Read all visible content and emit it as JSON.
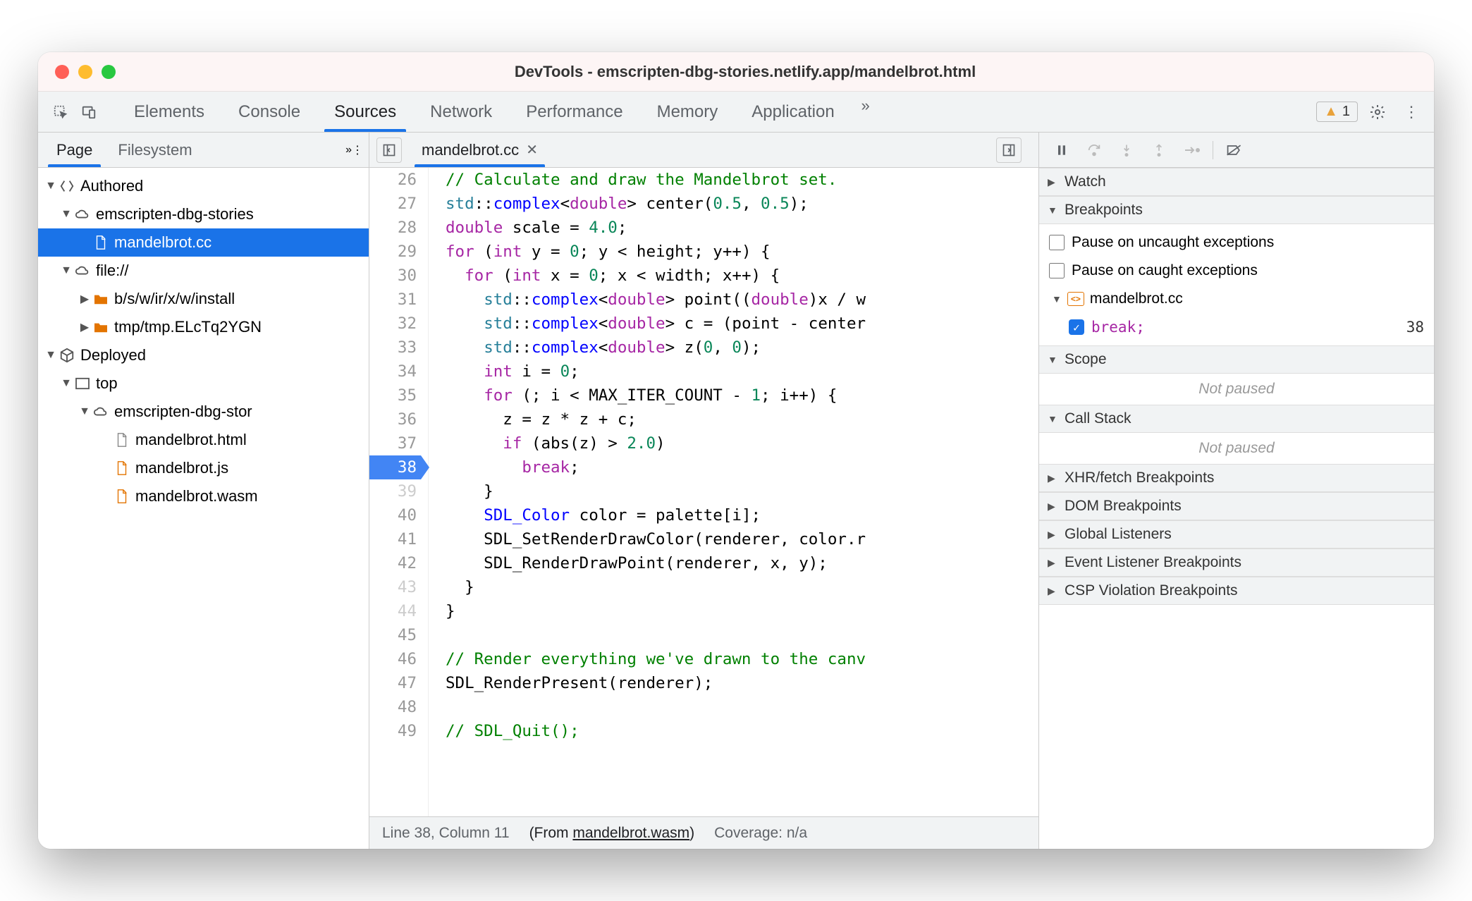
{
  "window_title": "DevTools - emscripten-dbg-stories.netlify.app/mandelbrot.html",
  "panel_tabs": [
    "Elements",
    "Console",
    "Sources",
    "Network",
    "Performance",
    "Memory",
    "Application"
  ],
  "active_panel": "Sources",
  "warning_count": "1",
  "sidebar": {
    "tabs": [
      "Page",
      "Filesystem"
    ],
    "active_tab": "Page",
    "tree": {
      "authored_label": "Authored",
      "domain1": "emscripten-dbg-stories",
      "file_cc": "mandelbrot.cc",
      "file_scheme": "file://",
      "folder1": "b/s/w/ir/x/w/install",
      "folder2": "tmp/tmp.ELcTq2YGN",
      "deployed_label": "Deployed",
      "top_label": "top",
      "domain2": "emscripten-dbg-stor",
      "dep_file1": "mandelbrot.html",
      "dep_file2": "mandelbrot.js",
      "dep_file3": "mandelbrot.wasm"
    }
  },
  "editor": {
    "filename": "mandelbrot.cc",
    "breakpoint_line": 38,
    "status_pos": "Line 38, Column 11",
    "status_from_prefix": "(From ",
    "status_from_link": "mandelbrot.wasm",
    "status_from_suffix": ")",
    "status_coverage": "Coverage: n/a"
  },
  "code_lines": [
    {
      "n": 26,
      "html": "<span class='tok-comment'>// Calculate and draw the Mandelbrot set.</span>"
    },
    {
      "n": 27,
      "html": "<span class='tok-ns'>std</span>::<span class='tok-type'>complex</span>&lt;<span class='tok-kw'>double</span>&gt; <span class='tok-id'>center</span>(<span class='tok-num'>0.5</span>, <span class='tok-num'>0.5</span>);"
    },
    {
      "n": 28,
      "html": "<span class='tok-kw'>double</span> scale = <span class='tok-num'>4.0</span>;"
    },
    {
      "n": 29,
      "html": "<span class='tok-kw'>for</span> (<span class='tok-kw'>int</span> y = <span class='tok-num'>0</span>; y &lt; height; y++) {"
    },
    {
      "n": 30,
      "html": "  <span class='tok-kw'>for</span> (<span class='tok-kw'>int</span> x = <span class='tok-num'>0</span>; x &lt; width; x++) {"
    },
    {
      "n": 31,
      "html": "    <span class='tok-ns'>std</span>::<span class='tok-type'>complex</span>&lt;<span class='tok-kw'>double</span>&gt; point((<span class='tok-kw'>double</span>)x / w"
    },
    {
      "n": 32,
      "html": "    <span class='tok-ns'>std</span>::<span class='tok-type'>complex</span>&lt;<span class='tok-kw'>double</span>&gt; c = (point - center"
    },
    {
      "n": 33,
      "html": "    <span class='tok-ns'>std</span>::<span class='tok-type'>complex</span>&lt;<span class='tok-kw'>double</span>&gt; z(<span class='tok-num'>0</span>, <span class='tok-num'>0</span>);"
    },
    {
      "n": 34,
      "html": "    <span class='tok-kw'>int</span> i = <span class='tok-num'>0</span>;"
    },
    {
      "n": 35,
      "html": "    <span class='tok-kw'>for</span> (; i &lt; MAX_ITER_COUNT - <span class='tok-num'>1</span>; i++) {"
    },
    {
      "n": 36,
      "html": "      z = z * z + c;"
    },
    {
      "n": 37,
      "html": "      <span class='tok-kw'>if</span> (abs(z) &gt; <span class='tok-num'>2.0</span>)"
    },
    {
      "n": 38,
      "bp": true,
      "html": "        <span class='tok-kw'>break</span>;"
    },
    {
      "n": 39,
      "end": true,
      "html": "    }"
    },
    {
      "n": 40,
      "html": "    <span class='tok-type'>SDL_Color</span> color = palette[i];"
    },
    {
      "n": 41,
      "html": "    SDL_SetRenderDrawColor(renderer, color.r"
    },
    {
      "n": 42,
      "html": "    SDL_RenderDrawPoint(renderer, x, y);"
    },
    {
      "n": 43,
      "end": true,
      "html": "  }"
    },
    {
      "n": 44,
      "end": true,
      "html": "}"
    },
    {
      "n": 45,
      "html": ""
    },
    {
      "n": 46,
      "html": "<span class='tok-comment'>// Render everything we've drawn to the canv</span>"
    },
    {
      "n": 47,
      "html": "SDL_RenderPresent(renderer);"
    },
    {
      "n": 48,
      "html": ""
    },
    {
      "n": 49,
      "html": "<span class='tok-comment'>// SDL_Quit();</span>"
    }
  ],
  "debug": {
    "sections": {
      "watch": "Watch",
      "breakpoints": "Breakpoints",
      "scope": "Scope",
      "callstack": "Call Stack",
      "xhr": "XHR/fetch Breakpoints",
      "dom": "DOM Breakpoints",
      "global": "Global Listeners",
      "event": "Event Listener Breakpoints",
      "csp": "CSP Violation Breakpoints"
    },
    "pause_uncaught": "Pause on uncaught exceptions",
    "pause_caught": "Pause on caught exceptions",
    "bp_file": "mandelbrot.cc",
    "bp_code": "break;",
    "bp_line": "38",
    "not_paused": "Not paused"
  }
}
